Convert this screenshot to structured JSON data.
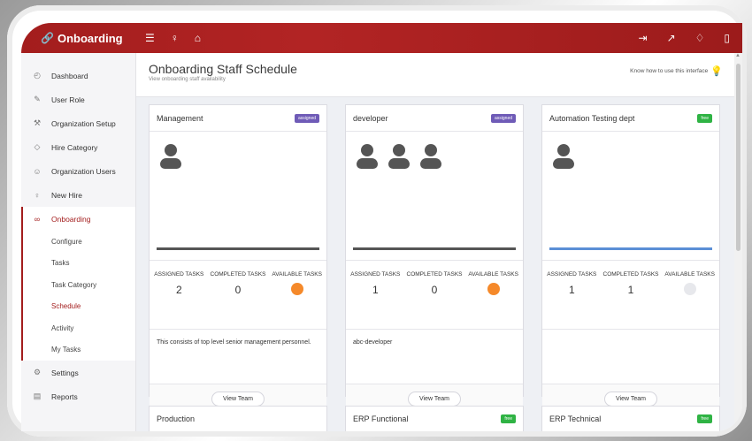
{
  "app": {
    "brand": "Onboarding"
  },
  "colors": {
    "accent": "#a31d1d",
    "assigned_badge": "#6f5bb7",
    "free_badge": "#2fb344",
    "available_dot": "#f5892a"
  },
  "topbar": {
    "icons_left": [
      "menu-icon",
      "user-icon",
      "lock-icon"
    ],
    "icons_right": [
      "logout-icon",
      "expand-icon",
      "bell-icon",
      "mobile-icon"
    ]
  },
  "sidebar": {
    "items": [
      {
        "label": "Dashboard",
        "icon": "dashboard-icon"
      },
      {
        "label": "User Role",
        "icon": "edit-icon"
      },
      {
        "label": "Organization Setup",
        "icon": "wrench-icon"
      },
      {
        "label": "Hire Category",
        "icon": "tag-icon"
      },
      {
        "label": "Organization Users",
        "icon": "users-icon"
      },
      {
        "label": "New Hire",
        "icon": "user-add-icon"
      },
      {
        "label": "Onboarding",
        "icon": "link-icon"
      }
    ],
    "submenu": [
      "Configure",
      "Tasks",
      "Task Category",
      "Schedule",
      "Activity",
      "My Tasks"
    ],
    "bottom_items": [
      {
        "label": "Settings",
        "icon": "gear-icon"
      },
      {
        "label": "Reports",
        "icon": "report-icon"
      }
    ]
  },
  "header": {
    "title": "Onboarding Staff Schedule",
    "subtitle": "View onboarding staff availability",
    "help": "Know how to use this interface"
  },
  "labels": {
    "assigned": "ASSIGNED TASKS",
    "completed": "COMPLETED TASKS",
    "available": "AVAILABLE TASKS",
    "view_team": "View Team"
  },
  "cards": [
    {
      "title": "Management",
      "badge": "assigned",
      "members": 1,
      "assigned": "2",
      "completed": "0",
      "available": "orange",
      "desc": "This consists of top level senior management personnel."
    },
    {
      "title": "developer",
      "badge": "assigned",
      "members": 3,
      "assigned": "1",
      "completed": "0",
      "available": "orange",
      "desc": "abc-developer"
    },
    {
      "title": "Automation Testing dept",
      "badge": "free",
      "members": 1,
      "assigned": "1",
      "completed": "1",
      "available": "grey",
      "desc": ""
    }
  ],
  "cards_partial": [
    {
      "title": "Production",
      "badge": ""
    },
    {
      "title": "ERP Functional",
      "badge": "free"
    },
    {
      "title": "ERP Technical",
      "badge": "free"
    }
  ]
}
